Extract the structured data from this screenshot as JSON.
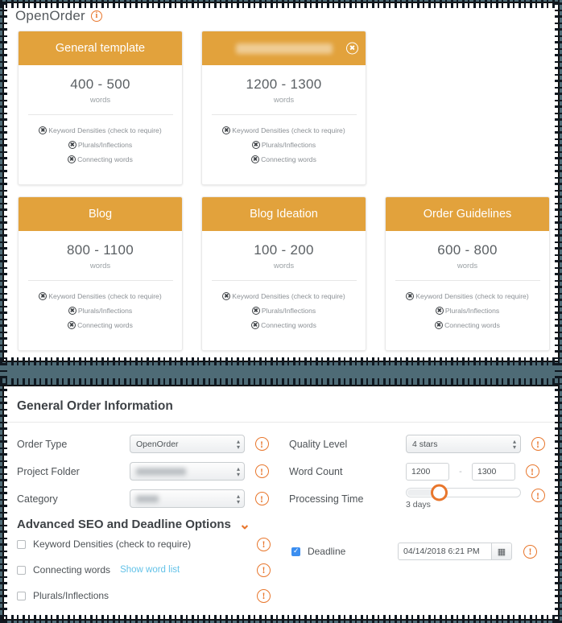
{
  "page": {
    "title": "OpenOrder",
    "info_icon": "info-icon"
  },
  "templates": {
    "words_label": "words",
    "features": [
      "Keyword Densities (check to require)",
      "Plurals/Inflections",
      "Connecting words"
    ],
    "cards": [
      {
        "title": "General template",
        "range": "400 - 500",
        "closable": false,
        "redacted": false
      },
      {
        "title": "",
        "range": "1200 - 1300",
        "closable": true,
        "redacted": true
      },
      {
        "title": "Blog",
        "range": "800 - 1100",
        "closable": false,
        "redacted": false
      },
      {
        "title": "Blog Ideation",
        "range": "100 - 200",
        "closable": false,
        "redacted": false
      },
      {
        "title": "Order Guidelines",
        "range": "600 - 800",
        "closable": false,
        "redacted": false
      }
    ]
  },
  "form": {
    "heading": "General Order Information",
    "left": {
      "order_type": {
        "label": "Order Type",
        "value": "OpenOrder",
        "redacted": false
      },
      "project_folder": {
        "label": "Project Folder",
        "value": "",
        "redacted": true
      },
      "category": {
        "label": "Category",
        "value": "",
        "redacted": true
      }
    },
    "right": {
      "quality_level": {
        "label": "Quality Level",
        "value": "4 stars"
      },
      "word_count": {
        "label": "Word Count",
        "min": "1200",
        "max": "1300",
        "separator": "-"
      },
      "processing_time": {
        "label": "Processing Time",
        "value": "3 days",
        "percent": 25
      }
    },
    "advanced": {
      "heading": "Advanced SEO and Deadline Options",
      "chevron": "chevron-down-icon",
      "checkboxes": [
        {
          "label": "Keyword Densities (check to require)",
          "checked": false,
          "link": ""
        },
        {
          "label": "Connecting words",
          "checked": false,
          "link": "Show word list"
        },
        {
          "label": "Plurals/Inflections",
          "checked": false,
          "link": ""
        }
      ],
      "deadline": {
        "label": "Deadline",
        "checked": true,
        "value": "04/14/2018 6:21 PM",
        "calendar_icon": "calendar-icon"
      }
    }
  },
  "colors": {
    "accent_orange": "#e8762c",
    "card_header": "#e2a23c",
    "background_slate": "#4e6b76",
    "link_blue": "#63c2e8",
    "checkbox_blue": "#3b8ef0"
  }
}
